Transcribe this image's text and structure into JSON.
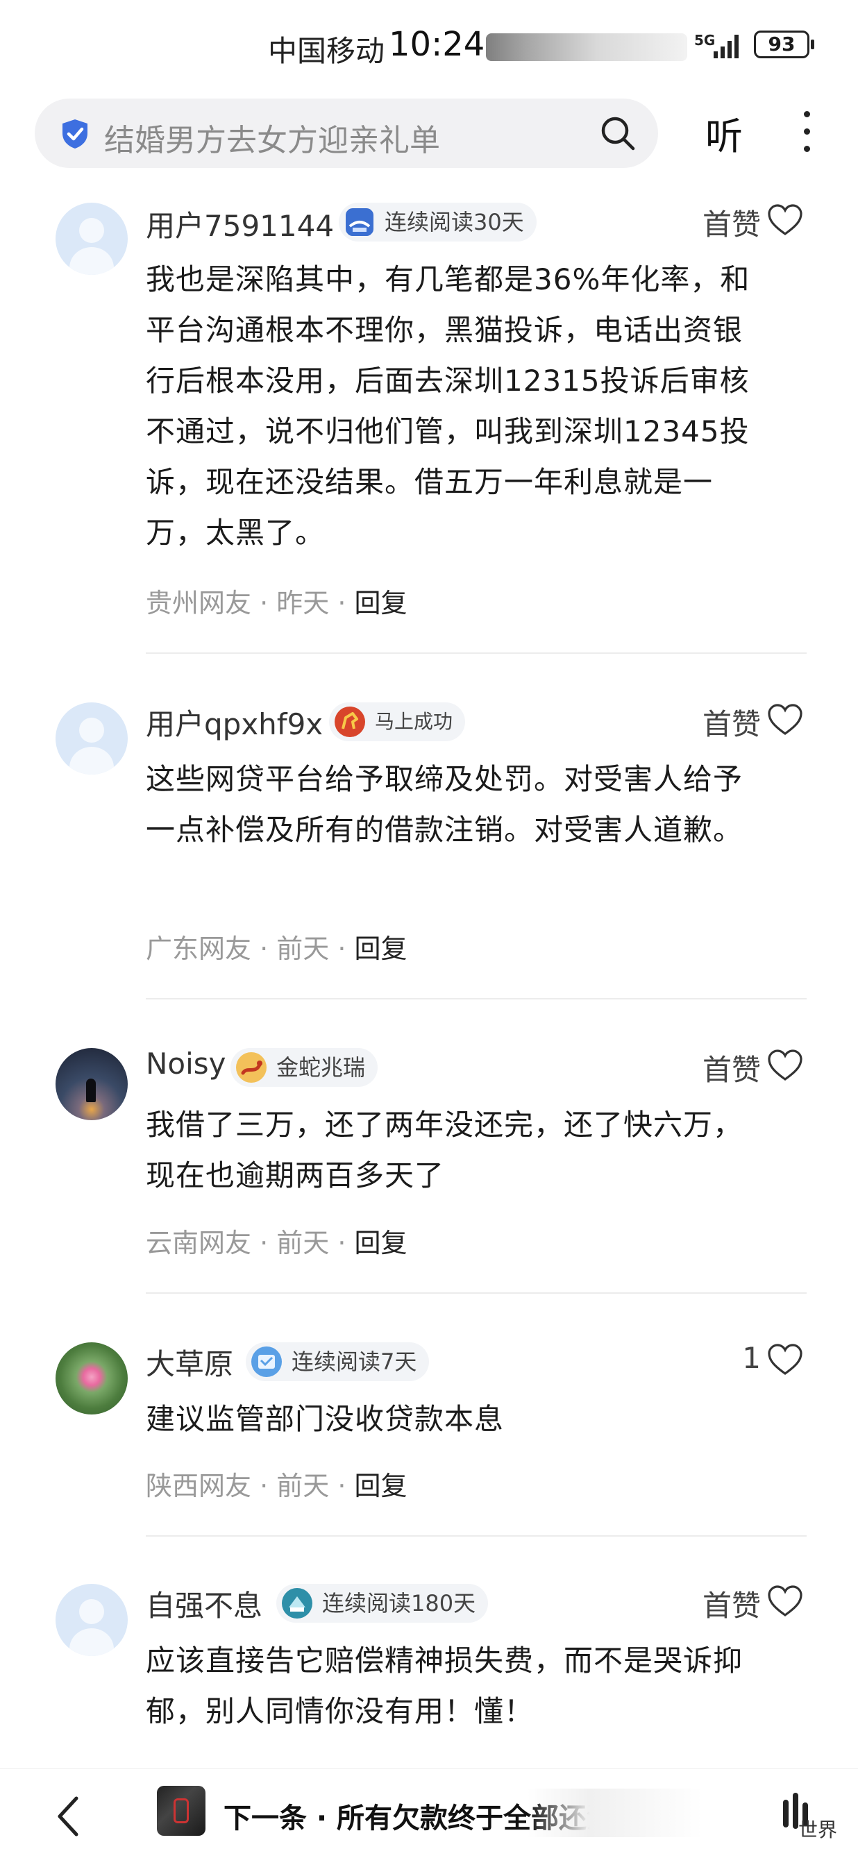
{
  "status_bar": {
    "carrier": "中国移动",
    "time": "10:24",
    "network": "5G",
    "battery": "93"
  },
  "search": {
    "query": "结婚男方去女方迎亲礼单",
    "listen_label": "听"
  },
  "colors": {
    "shield": "#3d6fe0",
    "meta_gray": "#999999",
    "badge_bg": "#f2f4f7"
  },
  "comments": [
    {
      "user": "用户7591144",
      "badge": "连续阅读30天",
      "badge_icon": "reading-streak-icon",
      "likes": "首赞",
      "text": "我也是深陷其中，有几笔都是36%年化率，和平台沟通根本不理你，黑猫投诉，电话出资银行后根本没用，后面去深圳12315投诉后审核不通过，说不归他们管，叫我到深圳12345投诉，现在还没结果。借五万一年利息就是一万，太黑了。",
      "region": "贵州网友",
      "time": "昨天",
      "reply": "回复"
    },
    {
      "user": "用户qpxhf9x",
      "badge": "马上成功",
      "badge_icon": "horse-icon",
      "likes": "首赞",
      "text": "这些网贷平台给予取缔及处罚。对受害人给予一点补偿及所有的借款注销。对受害人道歉。",
      "region": "广东网友",
      "time": "前天",
      "reply": "回复"
    },
    {
      "user": "Noisy",
      "badge": "金蛇兆瑞",
      "badge_icon": "snake-icon",
      "likes": "首赞",
      "text": "我借了三万，还了两年没还完，还了快六万，现在也逾期两百多天了",
      "region": "云南网友",
      "time": "前天",
      "reply": "回复"
    },
    {
      "user": "大草原",
      "badge": "连续阅读7天",
      "badge_icon": "reading-streak-icon",
      "likes": "1",
      "text": "建议监管部门没收贷款本息",
      "region": "陕西网友",
      "time": "前天",
      "reply": "回复"
    },
    {
      "user": "自强不息",
      "badge": "连续阅读180天",
      "badge_icon": "reading-streak-icon",
      "likes": "首赞",
      "text": "应该直接告它赔偿精神损失费，而不是哭诉抑郁，别人同情你没有用！懂！",
      "region": "",
      "time": "",
      "reply": ""
    }
  ],
  "bottom_bar": {
    "next_label": "下一条 · 所有欠款终于全部还清",
    "watermark": "世界"
  }
}
